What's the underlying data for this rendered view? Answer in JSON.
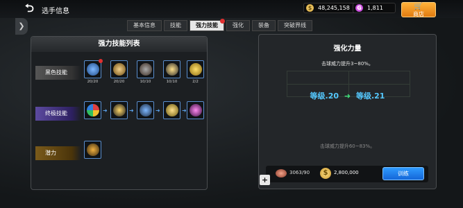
{
  "header": {
    "back_icon": "back-arrow-icon",
    "title": "选手信息",
    "gold": "48,245,158",
    "gems": "1,811",
    "shop_label": "商店"
  },
  "tabs": [
    {
      "label": "基本信息",
      "active": false
    },
    {
      "label": "技能",
      "active": false
    },
    {
      "label": "强力技能",
      "active": true,
      "badge": true
    },
    {
      "label": "强化",
      "active": false
    },
    {
      "label": "装备",
      "active": false
    },
    {
      "label": "突破界线",
      "active": false
    }
  ],
  "skill_list": {
    "title": "强力技能列表",
    "rows": [
      {
        "label": "黑色技能",
        "skills": [
          {
            "count": "20/20",
            "icon": "racket-icon",
            "badge": true
          },
          {
            "count": "20/20",
            "icon": "arm-icon"
          },
          {
            "count": "10/10",
            "icon": "helmet-icon"
          },
          {
            "count": "10/10",
            "icon": "star-swing-icon"
          },
          {
            "count": "2/2",
            "icon": "moon-icon"
          }
        ]
      },
      {
        "label": "终极技能",
        "skills": [
          {
            "icon": "color-wheel-icon"
          },
          {
            "icon": "star-player-icon"
          },
          {
            "icon": "racket-icon"
          },
          {
            "icon": "star-swing-icon"
          },
          {
            "icon": "purple-shoe-icon"
          }
        ]
      },
      {
        "label": "潜力",
        "skills": [
          {
            "icon": "potential-icon"
          }
        ]
      }
    ]
  },
  "enhance": {
    "title": "强化力量",
    "desc": "击球威力提升3~80%。",
    "level_from": "等级.20",
    "level_to": "等级.21",
    "desc_next": "击球威力提升60~83%。",
    "ball_count": "3063/90",
    "gold_cost": "2,800,000",
    "train_label": "训练"
  },
  "colors": {
    "accent_blue": "#54c8ff",
    "train_button": "#1f80f0",
    "shop_button": "#f0901e"
  }
}
